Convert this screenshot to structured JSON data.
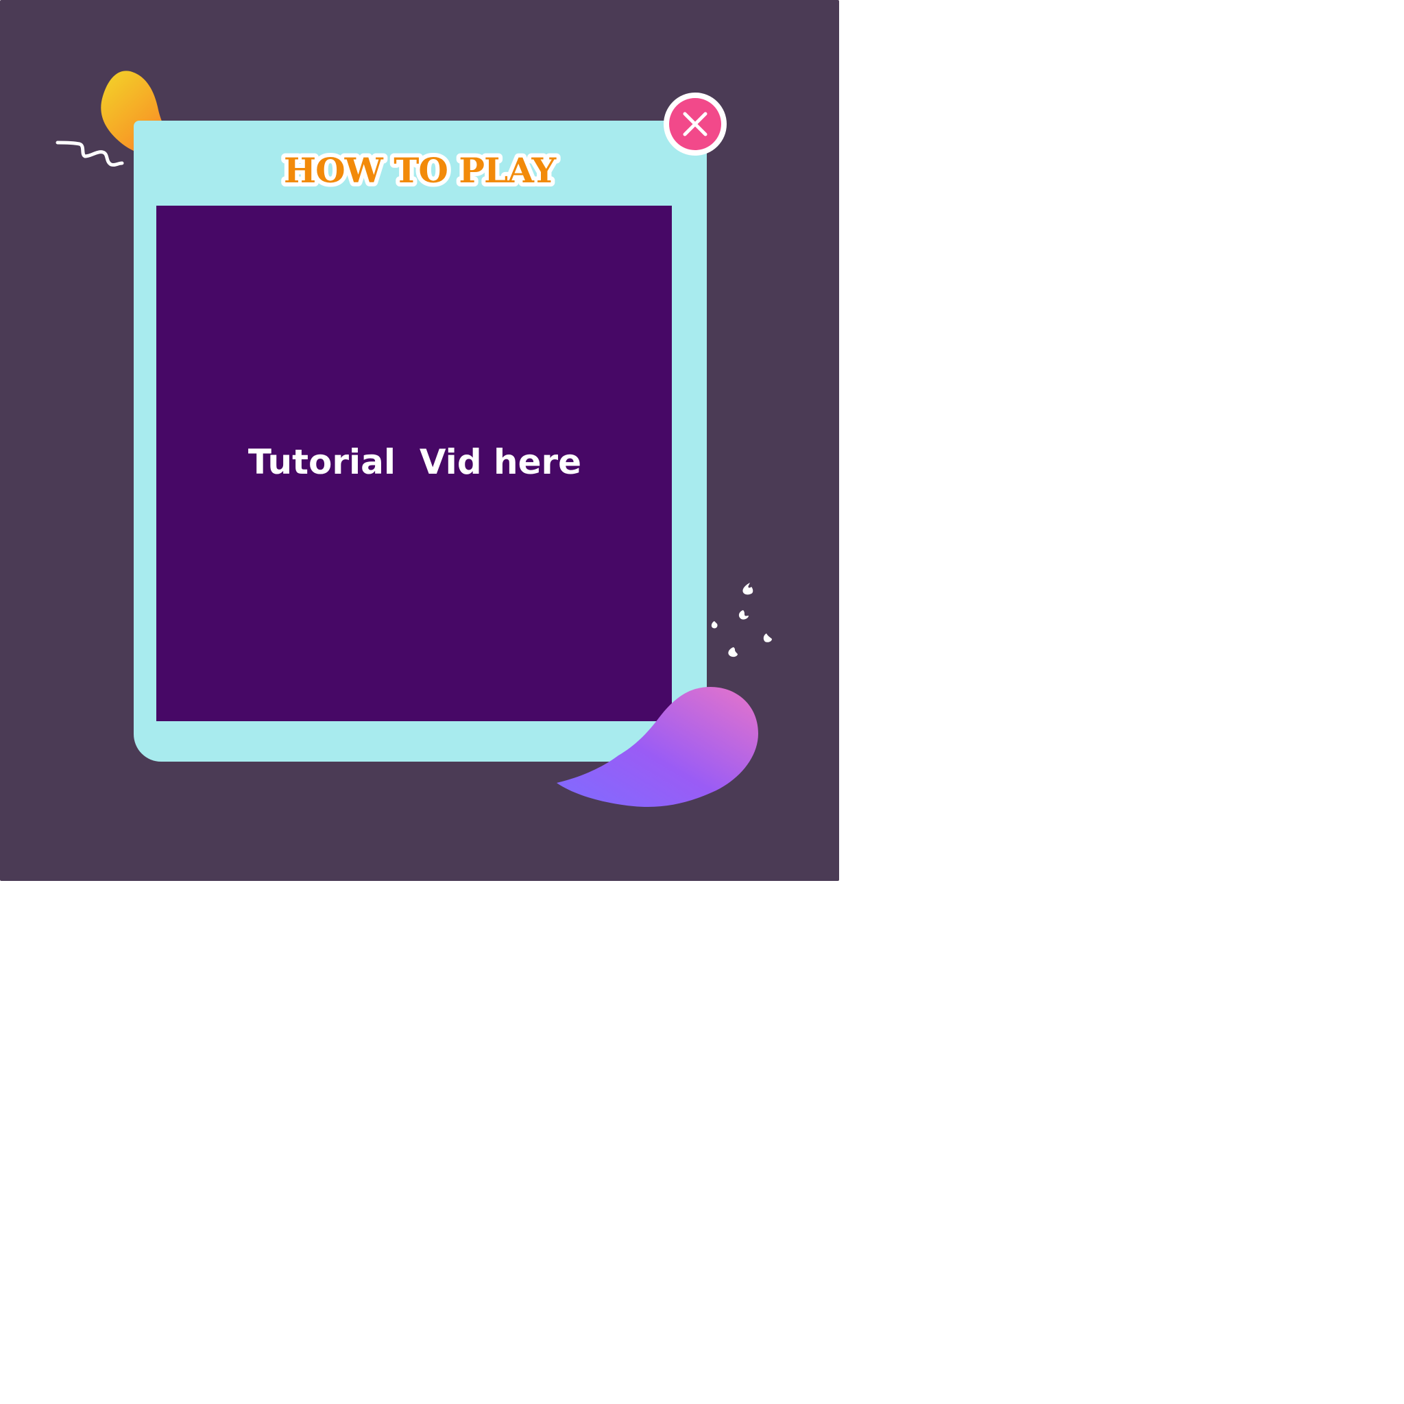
{
  "dialog": {
    "title": "HOW TO PLAY",
    "video_placeholder": "Tutorial  Vid here",
    "close_icon": "close-icon"
  },
  "colors": {
    "background": "#4b3b55",
    "panel": "#a8ebee",
    "video_area": "#470866",
    "title_fill": "#f28a0a",
    "title_outline": "#ffffff",
    "close_button": "#f2498a",
    "orange_blob": [
      "#f2d02a",
      "#ff6a2e"
    ],
    "purple_blob": [
      "#8a5cff",
      "#d672d4"
    ]
  }
}
